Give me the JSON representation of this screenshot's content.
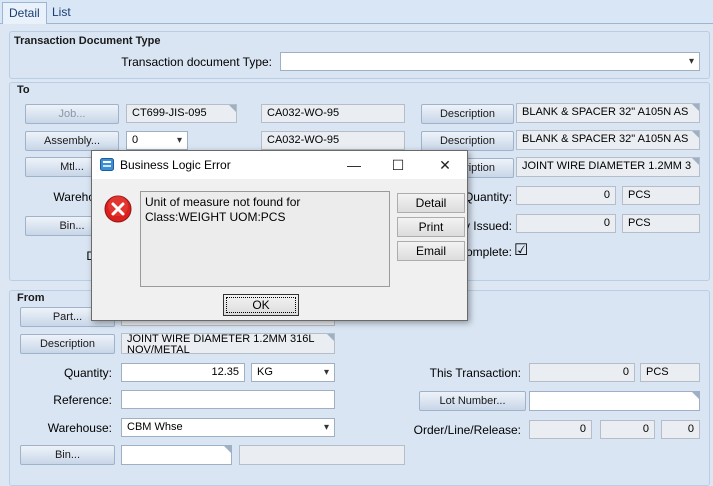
{
  "tabs": {
    "detail": "Detail",
    "list": "List"
  },
  "tdt": {
    "group_title": "Transaction Document Type",
    "label": "Transaction document Type:",
    "value": ""
  },
  "to": {
    "group_title": "To",
    "job_btn": "Job...",
    "job_value": "CT699-JIS-095",
    "job_value2": "CA032-WO-95",
    "assembly_btn": "Assembly...",
    "assembly_value": "0",
    "assembly_value2": "CA032-WO-95",
    "mtl_btn": "Mtl...",
    "desc_btn": "Description",
    "desc1": "BLANK & SPACER 32\" A105N AS",
    "desc2": "BLANK & SPACER 32\" A105N AS",
    "desc3": "JOINT WIRE DIAMETER 1.2MM 3",
    "warehouse_label": "Wareho",
    "bin_btn": "Bin...",
    "partial_label": "D",
    "quantity_label": "Quantity:",
    "quantity_value": "0",
    "quantity_uom": "PCS",
    "issued_label": "y Issued:",
    "issued_value": "0",
    "issued_uom": "PCS",
    "complete_label": "omplete:",
    "complete_check": "☑"
  },
  "from": {
    "group_title": "From",
    "part_btn": "Part...",
    "part_value": "",
    "desc_btn": "Description",
    "desc_value": "JOINT WIRE DIAMETER 1.2MM 316L NOV/METAL",
    "quantity_label": "Quantity:",
    "quantity_value": "12.35",
    "quantity_uom": "KG",
    "reference_label": "Reference:",
    "reference_value": "",
    "warehouse_label": "Warehouse:",
    "warehouse_value": "CBM Whse",
    "bin_btn": "Bin...",
    "bin_value": "",
    "bin_desc": "",
    "this_txn_label": "This Transaction:",
    "this_txn_value": "0",
    "this_txn_uom": "PCS",
    "lot_btn": "Lot Number...",
    "lot_value": "",
    "olr_label": "Order/Line/Release:",
    "order": "0",
    "line": "0",
    "release": "0"
  },
  "dialog": {
    "title": "Business Logic Error",
    "minimize": "—",
    "maximize": "☐",
    "close": "✕",
    "message": "Unit of measure not found for Class:WEIGHT UOM:PCS",
    "detail_btn": "Detail",
    "print_btn": "Print",
    "email_btn": "Email",
    "ok_btn": "OK",
    "error_icon_color": "#d9201c"
  }
}
